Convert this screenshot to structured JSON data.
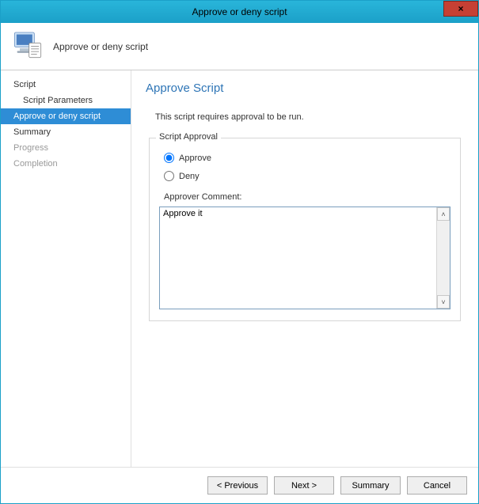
{
  "titlebar": {
    "title": "Approve or deny script",
    "close": "×"
  },
  "header": {
    "title": "Approve or deny script"
  },
  "nav": {
    "script": "Script",
    "script_parameters": "Script Parameters",
    "approve_or_deny": "Approve or deny script",
    "summary": "Summary",
    "progress": "Progress",
    "completion": "Completion"
  },
  "content": {
    "page_title": "Approve Script",
    "instruction": "This script requires approval to be run.",
    "group_legend": "Script Approval",
    "approve_label": "Approve",
    "deny_label": "Deny",
    "selected": "approve",
    "comment_label": "Approver Comment:",
    "comment_value": "Approve it"
  },
  "footer": {
    "previous": "< Previous",
    "next": "Next >",
    "summary": "Summary",
    "cancel": "Cancel"
  }
}
